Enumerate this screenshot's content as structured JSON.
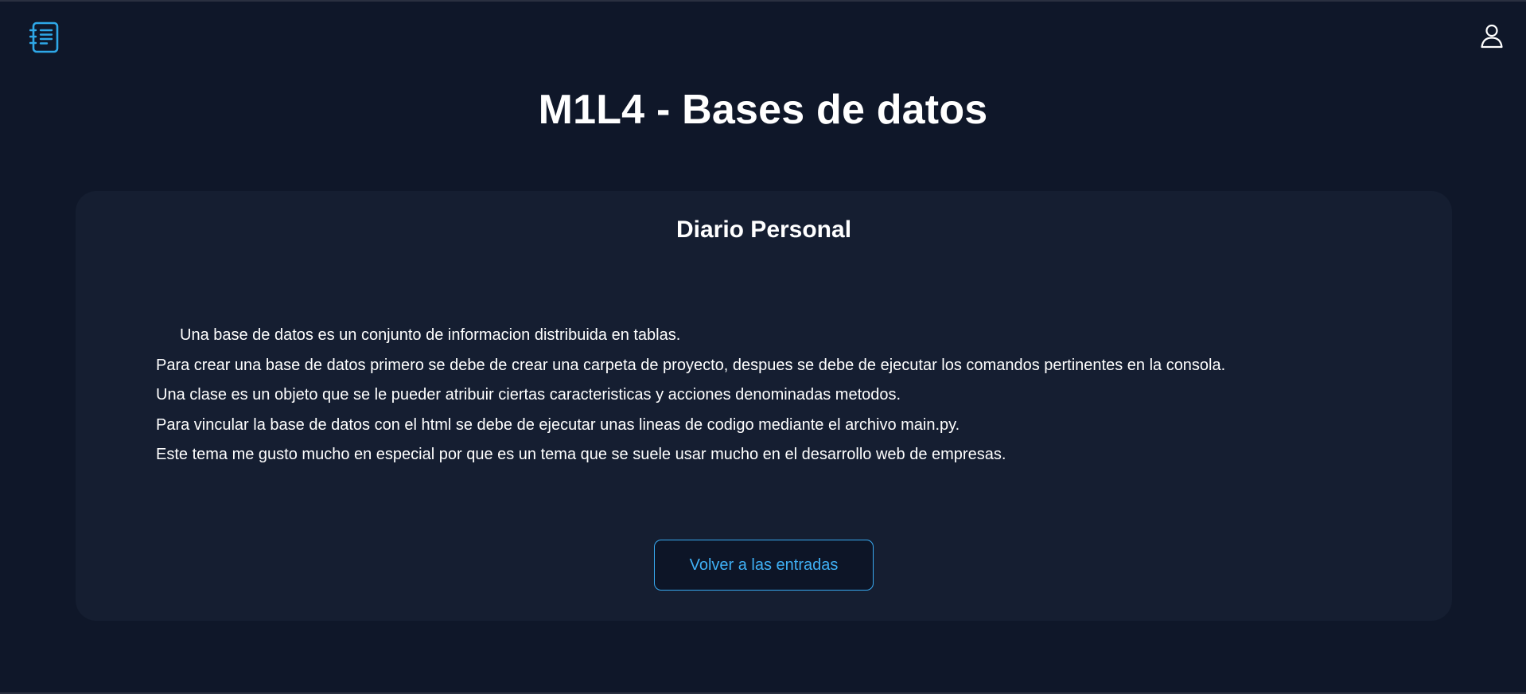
{
  "header": {
    "logo_icon": "notebook-list-icon",
    "user_icon": "user-icon",
    "accent_color": "#2ea8e8"
  },
  "page": {
    "title": "M1L4 - Bases de datos"
  },
  "card": {
    "title": "Diario Personal",
    "paragraphs": [
      "Una base de datos es un conjunto de informacion distribuida en tablas.",
      "Para crear una base de datos primero se debe de crear una carpeta de proyecto, despues se debe de ejecutar los comandos pertinentes en la consola.",
      "Una clase es un objeto que se le pueder atribuir ciertas caracteristicas y acciones denominadas metodos.",
      "Para vincular la base de datos con el html se debe de ejecutar unas lineas de codigo mediante el archivo main.py.",
      "Este tema me gusto mucho en especial por que es un tema que se suele usar mucho en el desarrollo web de empresas."
    ],
    "back_button_label": "Volver a las entradas"
  }
}
